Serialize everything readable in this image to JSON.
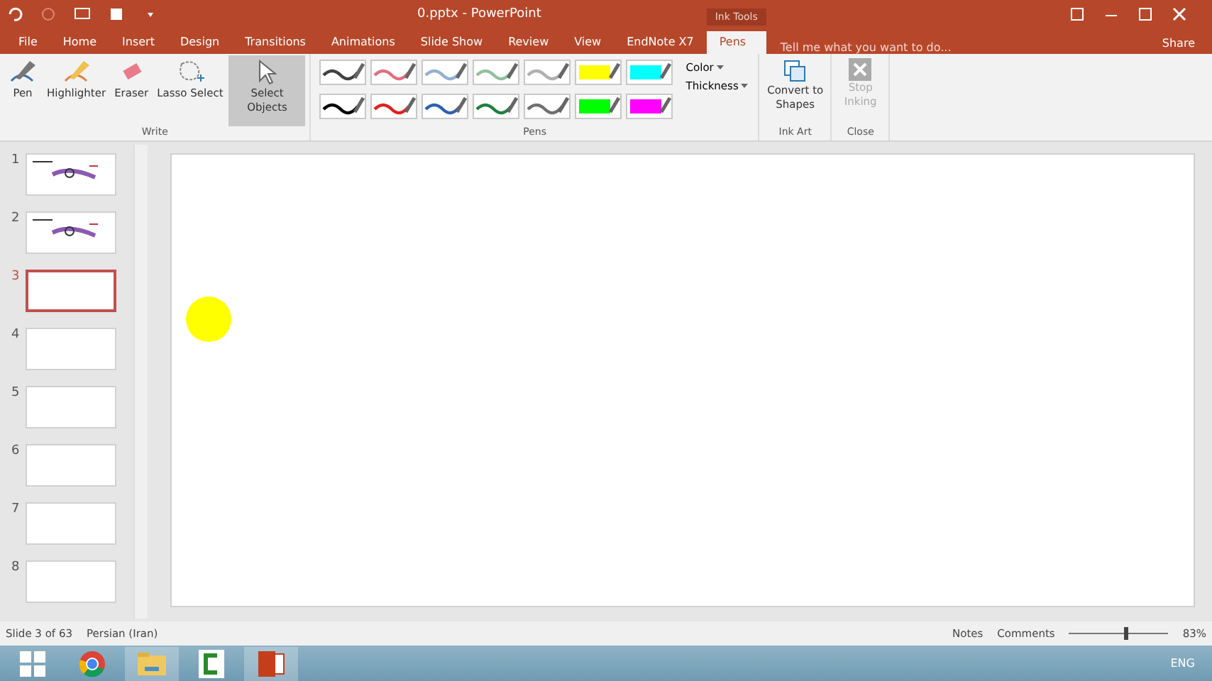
{
  "window": {
    "title": "0.pptx - PowerPoint"
  },
  "context_tab_group": "Ink Tools",
  "tabs": [
    {
      "label": "File",
      "selected": false
    },
    {
      "label": "Home",
      "selected": false
    },
    {
      "label": "Insert",
      "selected": false
    },
    {
      "label": "Design",
      "selected": false
    },
    {
      "label": "Transitions",
      "selected": false
    },
    {
      "label": "Animations",
      "selected": false
    },
    {
      "label": "Slide Show",
      "selected": false
    },
    {
      "label": "Review",
      "selected": false
    },
    {
      "label": "View",
      "selected": false
    },
    {
      "label": "EndNote X7",
      "selected": false
    },
    {
      "label": "Pens",
      "selected": true
    }
  ],
  "tell_me": {
    "placeholder": "Tell me what you want to do..."
  },
  "share": "Share",
  "write_group": {
    "label": "Write",
    "tools": [
      {
        "kind": "pen",
        "label": "Pen",
        "selected": false
      },
      {
        "kind": "highlighter",
        "label": "Highlighter",
        "selected": false
      },
      {
        "kind": "eraser",
        "label": "Eraser",
        "selected": false
      },
      {
        "kind": "lasso",
        "label": "Lasso Select",
        "selected": false
      },
      {
        "kind": "select",
        "label": "Select Objects",
        "selected": true
      }
    ]
  },
  "pens_group": {
    "label": "Pens",
    "pens": [
      {
        "kind": "pen",
        "color": "#404040"
      },
      {
        "kind": "pen",
        "color": "#e07080"
      },
      {
        "kind": "pen",
        "color": "#90b0d0"
      },
      {
        "kind": "pen",
        "color": "#90c0a0"
      },
      {
        "kind": "pen",
        "color": "#b0b0b0"
      },
      {
        "kind": "highlighter",
        "color": "#ffff00"
      },
      {
        "kind": "highlighter",
        "color": "#00ffff"
      },
      {
        "kind": "pen",
        "color": "#000000"
      },
      {
        "kind": "pen",
        "color": "#e02020"
      },
      {
        "kind": "pen",
        "color": "#3060b0"
      },
      {
        "kind": "pen",
        "color": "#208040"
      },
      {
        "kind": "pen",
        "color": "#707070"
      },
      {
        "kind": "highlighter",
        "color": "#00ff00"
      },
      {
        "kind": "highlighter",
        "color": "#ff00ff"
      }
    ],
    "color_label": "Color",
    "thickness_label": "Thickness"
  },
  "ink_art_group": {
    "label": "Ink Art",
    "button": "Convert to Shapes"
  },
  "close_group": {
    "label": "Close",
    "button": "Stop Inking",
    "disabled": true
  },
  "slides": [
    {
      "number": "1",
      "kind": "sketch",
      "selected": false
    },
    {
      "number": "2",
      "kind": "sketch",
      "selected": false
    },
    {
      "number": "3",
      "kind": "blank",
      "selected": true
    },
    {
      "number": "4",
      "kind": "blank",
      "selected": false
    },
    {
      "number": "5",
      "kind": "blank",
      "selected": false
    },
    {
      "number": "6",
      "kind": "blank",
      "selected": false
    },
    {
      "number": "7",
      "kind": "blank",
      "selected": false
    },
    {
      "number": "8",
      "kind": "blank",
      "selected": false
    }
  ],
  "status_bar": {
    "slide": "Slide 3 of 63",
    "language": "Persian (Iran)",
    "notes": "Notes",
    "comments": "Comments",
    "zoom": "83%",
    "zoom_slider": {
      "level": 0.55
    }
  },
  "taskbar": {
    "keyboard": "ENG"
  }
}
